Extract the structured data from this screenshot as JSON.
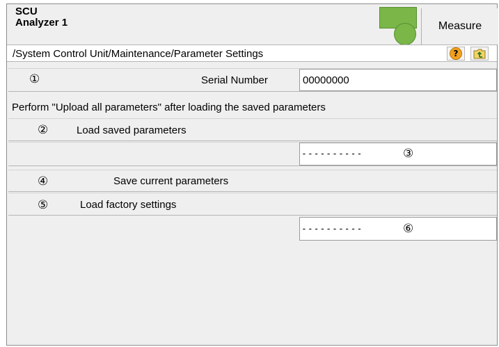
{
  "header": {
    "system": "SCU",
    "analyzer": "Analyzer 1",
    "measure_label": "Measure",
    "status_color": "#7ab648"
  },
  "path": {
    "text": "/System Control Unit/Maintenance/Parameter Settings",
    "help_icon": "help-icon",
    "up_folder_icon": "folder-up-icon"
  },
  "serial": {
    "marker": "①",
    "label": "Serial Number",
    "value": "00000000"
  },
  "notice": "Perform \"Upload all parameters\" after loading the saved parameters",
  "load_saved": {
    "marker": "②",
    "label": "Load saved parameters",
    "field_value": "----------",
    "field_marker": "③"
  },
  "save_current": {
    "marker": "④",
    "label": "Save current parameters"
  },
  "load_factory": {
    "marker": "⑤",
    "label": "Load factory settings",
    "field_value": "----------",
    "field_marker": "⑥"
  }
}
